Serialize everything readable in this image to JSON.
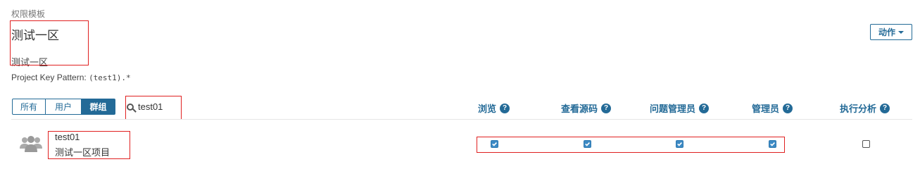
{
  "header": {
    "breadcrumb": "权限模板",
    "title": "测试一区",
    "description": "测试一区",
    "pattern_label": "Project Key Pattern:",
    "pattern_value": "(test1).*",
    "action_button": "动作"
  },
  "filter": {
    "tabs": [
      {
        "label": "所有",
        "active": false
      },
      {
        "label": "用户",
        "active": false
      },
      {
        "label": "群组",
        "active": true
      }
    ],
    "search_value": "test01"
  },
  "columns": [
    "浏览",
    "查看源码",
    "问题管理员",
    "管理员",
    "执行分析"
  ],
  "rows": [
    {
      "icon": "group-icon",
      "name": "test01",
      "description": "测试一区项目",
      "permissions": [
        true,
        true,
        true,
        true,
        false
      ]
    }
  ],
  "colors": {
    "accent": "#236a97",
    "checkbox_checked": "#3d8ac4",
    "annotation": "#e02020"
  }
}
